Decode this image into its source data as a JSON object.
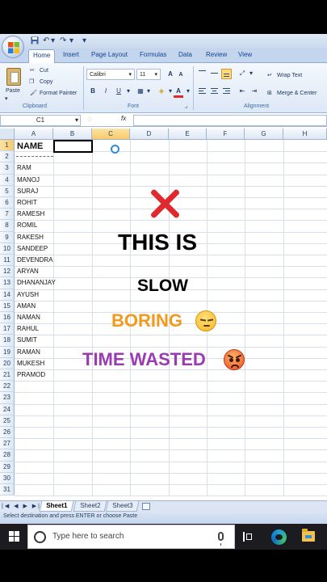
{
  "quick_access": {
    "customize_glyph": "▾"
  },
  "tabs": [
    "Home",
    "Insert",
    "Page Layout",
    "Formulas",
    "Data",
    "Review",
    "View"
  ],
  "clipboard": {
    "paste": "Paste",
    "cut": "Cut",
    "copy": "Copy",
    "format_painter": "Format Painter",
    "label": "Clipboard"
  },
  "font": {
    "name": "Calibri",
    "size": "11",
    "bold": "B",
    "italic": "I",
    "underline": "U",
    "grow": "A",
    "shrink": "A",
    "color_letter": "A",
    "label": "Font"
  },
  "alignment": {
    "wrap_text": "Wrap Text",
    "merge_center": "Merge & Center",
    "label": "Alignment"
  },
  "formula_bar": {
    "name_box": "C1",
    "fx": "fx",
    "value": ""
  },
  "columns": [
    "A",
    "B",
    "C",
    "D",
    "E",
    "F",
    "G",
    "H"
  ],
  "rows": [
    "1",
    "2",
    "3",
    "4",
    "5",
    "6",
    "7",
    "8",
    "9",
    "10",
    "11",
    "12",
    "13",
    "14",
    "15",
    "16",
    "17",
    "18",
    "19",
    "20",
    "21",
    "22",
    "23",
    "24",
    "25",
    "26",
    "27",
    "28",
    "29",
    "30",
    "31"
  ],
  "cells": {
    "header": "NAME",
    "names": [
      "RAM",
      "MANOJ",
      "SURAJ",
      "ROHIT",
      "RAMESH",
      "ROMIL",
      "RAKESH",
      "SANDEEP",
      "DEVENDRA",
      "ARYAN",
      "DHANANJAY",
      "AYUSH",
      "AMAN",
      "NAMAN",
      "RAHUL",
      "SUMIT",
      "RAMAN",
      "MUKESH",
      "PRAMOD"
    ]
  },
  "overlay": {
    "line1": "THIS IS",
    "line2": "SLOW",
    "line3": "BORING",
    "line4": "TIME WASTED",
    "colors": {
      "x": "#e0282e",
      "boring": "#f39a1c",
      "wasted": "#9a3bb1"
    }
  },
  "sheets": [
    "Sheet1",
    "Sheet2",
    "Sheet3"
  ],
  "status": "Select destination and press ENTER or choose Paste",
  "taskbar": {
    "search_placeholder": "Type here to search"
  }
}
